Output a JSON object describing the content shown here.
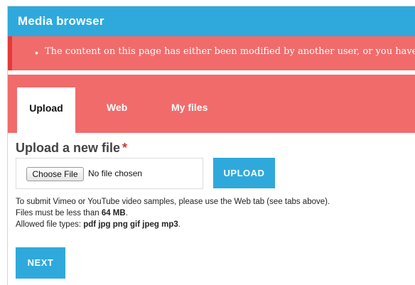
{
  "window": {
    "title": "Media browser"
  },
  "alert": {
    "bullet": "•",
    "message": "The content on this page has either been modified by another user, or you have alread"
  },
  "tabs": [
    {
      "label": "Upload",
      "active": true
    },
    {
      "label": "Web",
      "active": false
    },
    {
      "label": "My files",
      "active": false
    }
  ],
  "upload": {
    "heading": "Upload a new file",
    "required_mark": "*",
    "choose_file_label": "Choose File",
    "file_status": "No file chosen",
    "upload_button": "UPLOAD"
  },
  "help": {
    "line1": "To submit Vimeo or YouTube video samples, please use the Web tab (see tabs above).",
    "line2_prefix": "Files must be less than",
    "max_size": "64 MB",
    "line2_suffix": ".",
    "line3_prefix": "Allowed file types:",
    "file_types": "pdf jpg png gif jpeg mp3",
    "line3_suffix": "."
  },
  "actions": {
    "next_button": "NEXT"
  },
  "colors": {
    "primary_blue": "#2fa9dc",
    "alert_red": "#f16b6b",
    "alert_border": "#e23a3a",
    "required_red": "#d9342b"
  }
}
